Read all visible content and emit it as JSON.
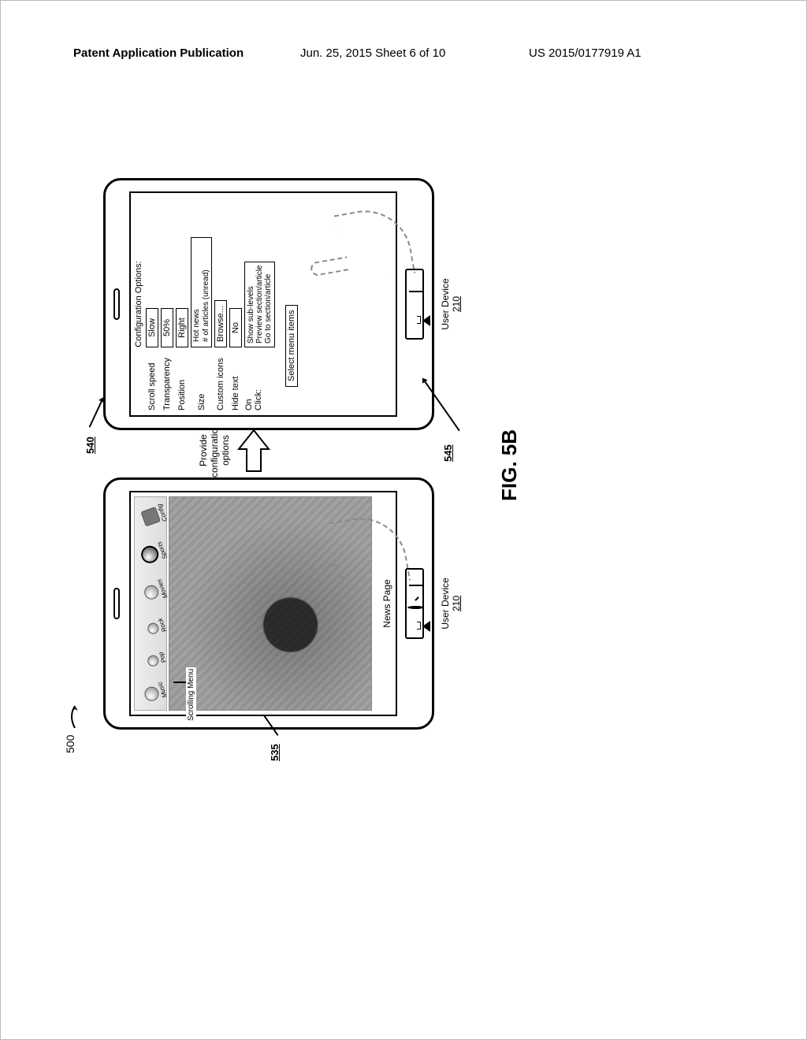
{
  "header": {
    "left": "Patent Application Publication",
    "mid": "Jun. 25, 2015  Sheet 6 of 10",
    "right": "US 2015/0177919 A1"
  },
  "ref": {
    "r500": "500",
    "r535": "535",
    "r540": "540",
    "r545": "545"
  },
  "left_device": {
    "carousel": [
      "Music",
      "Pop",
      "Rock",
      "Movies",
      "Sports",
      "Config"
    ],
    "scroll_menu_callout": "Scrolling Menu",
    "page_label": "News Page",
    "device_label": "User Device",
    "device_num": "210"
  },
  "center": {
    "arrow_label": "Provide\nconfiguration\noptions"
  },
  "right_device": {
    "title": "Configuration Options:",
    "rows": {
      "scroll_speed": {
        "label": "Scroll speed",
        "value": "Slow"
      },
      "transparency": {
        "label": "Transparency",
        "value": "50%"
      },
      "position": {
        "label": "Position",
        "value": "Right"
      },
      "size": {
        "label": "Size",
        "value1": "Hot news",
        "value2": "# of articles (unread)"
      },
      "custom_icons": {
        "label": "Custom icons",
        "value": "Browse..."
      },
      "hide_text": {
        "label": "Hide text",
        "value": "No"
      },
      "on_click": {
        "label": "On\nClick:",
        "opt1": "Show sub-levels",
        "opt2": "Preview section/article",
        "opt3": "Go to section/article"
      }
    },
    "select_button": "Select menu items",
    "device_label": "User Device",
    "device_num": "210"
  },
  "figure_label": "FIG. 5B"
}
